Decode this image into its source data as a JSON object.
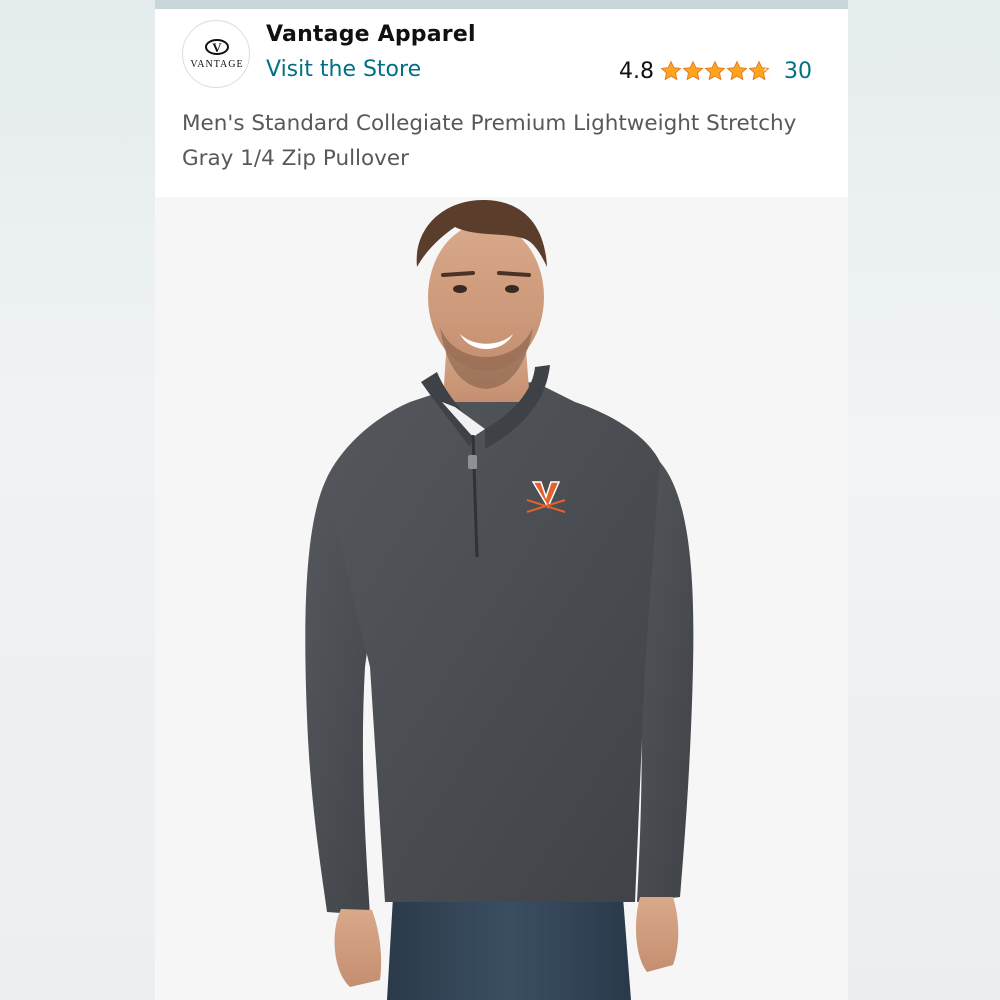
{
  "listing": {
    "brand_name": "Vantage Apparel",
    "store_link": "Visit the Store",
    "rating_value": "4.8",
    "rating_stars": 4.8,
    "review_count": "30",
    "product_title": "Men's Standard Collegiate Premium Lightweight Stretchy Gray 1/4 Zip Pullover",
    "logo_text": "VANTAGE",
    "logo_glyph": "V"
  },
  "colors": {
    "link": "#007185",
    "star": "#FFA41C",
    "text": "#0f1111",
    "title": "#565959",
    "garment": "#4a4d51",
    "emblem": "#e1612f"
  },
  "icons": {
    "brand": "vantage-logo-icon",
    "stars": "star-icon"
  },
  "image": {
    "subject": "product-photo-model-gray-quarter-zip"
  }
}
